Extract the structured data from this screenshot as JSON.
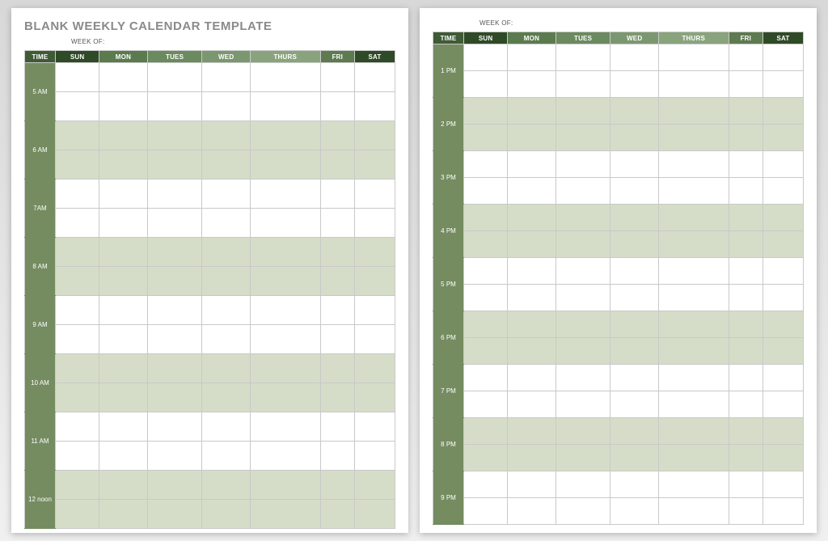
{
  "title": "BLANK WEEKLY CALENDAR TEMPLATE",
  "week_of_label": "WEEK OF:",
  "headers": {
    "time": "TIME",
    "days": [
      "SUN",
      "MON",
      "TUES",
      "WED",
      "THURS",
      "FRI",
      "SAT"
    ]
  },
  "page1_times": [
    "5 AM",
    "6 AM",
    "7AM",
    "8 AM",
    "9 AM",
    "10 AM",
    "11 AM",
    "12 noon"
  ],
  "page2_times": [
    "1 PM",
    "2 PM",
    "3 PM",
    "4 PM",
    "5 PM",
    "6 PM",
    "7 PM",
    "8 PM",
    "9 PM"
  ]
}
